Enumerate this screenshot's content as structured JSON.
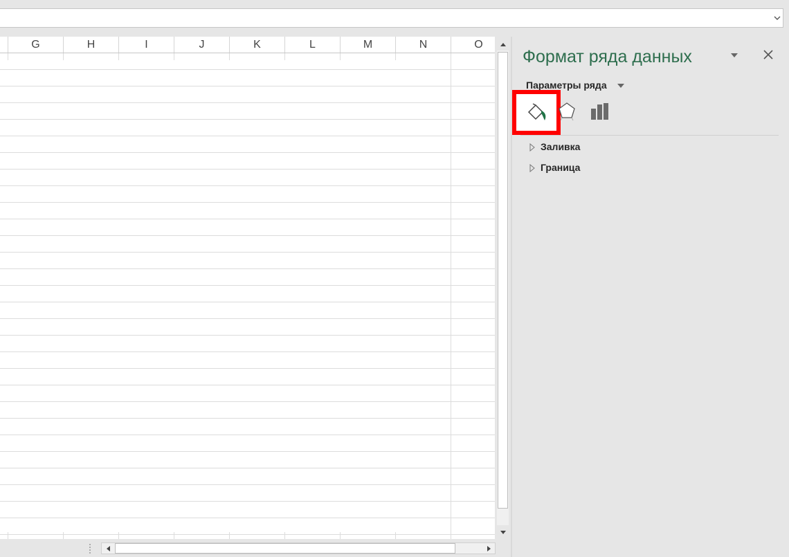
{
  "formula_bar": {
    "value": ""
  },
  "sheet": {
    "columns": [
      "G",
      "H",
      "I",
      "J",
      "K",
      "L",
      "M",
      "N",
      "O"
    ]
  },
  "format_pane": {
    "title": "Формат ряда данных",
    "subtitle": "Параметры ряда",
    "tabs": [
      {
        "icon": "fill-line-icon",
        "selected": true
      },
      {
        "icon": "effects-pentagon-icon",
        "selected": false
      },
      {
        "icon": "series-options-bar-chart-icon",
        "selected": false
      }
    ],
    "sections": [
      {
        "label": "Заливка",
        "expanded": false
      },
      {
        "label": "Граница",
        "expanded": false
      }
    ],
    "colors": {
      "title": "#2e6e4e",
      "highlight": "#ff0000",
      "icon_accent": "#217346"
    }
  }
}
